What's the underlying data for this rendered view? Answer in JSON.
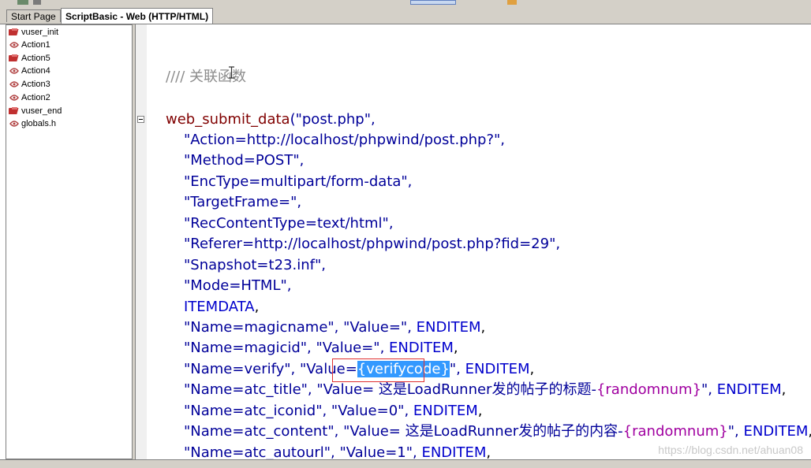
{
  "tabs": [
    {
      "label": "Start Page"
    },
    {
      "label": "ScriptBasic - Web (HTTP/HTML)"
    }
  ],
  "tree": {
    "items": [
      {
        "label": "vuser_init",
        "icon": "vuser-icon"
      },
      {
        "label": "Action1",
        "icon": "action-icon"
      },
      {
        "label": "Action5",
        "icon": "vuser-icon"
      },
      {
        "label": "Action4",
        "icon": "action-icon"
      },
      {
        "label": "Action3",
        "icon": "action-icon"
      },
      {
        "label": "Action2",
        "icon": "action-icon"
      },
      {
        "label": "vuser_end",
        "icon": "vuser-icon"
      },
      {
        "label": "globals.h",
        "icon": "action-icon"
      }
    ]
  },
  "code": {
    "comment": "//// 关联函数",
    "line1_fn": "web_submit_data",
    "line1_rest": "(\"post.php\",",
    "lines": [
      "\"Action=http://localhost/phpwind/post.php?\",",
      "\"Method=POST\",",
      "\"EncType=multipart/form-data\",",
      "\"TargetFrame=\",",
      "\"RecContentType=text/html\",",
      "\"Referer=http://localhost/phpwind/post.php?fid=29\",",
      "\"Snapshot=t23.inf\",",
      "\"Mode=HTML\","
    ],
    "itemdata": "ITEMDATA",
    "enditem": "ENDITEM",
    "row_magicname": "\"Name=magicname\", \"Value=\", ",
    "row_magicid": "\"Name=magicid\", \"Value=\", ",
    "row_verify_a": "\"Name=verify\", \"Value=",
    "row_verify_sel": "{verifycode}",
    "row_verify_b": "\", ",
    "row_title_a": "\"Name=atc_title\", \"Value= 这是LoadRunner发的帖子的标题-",
    "row_title_param": "{randomnum}",
    "row_title_b": "\", ",
    "row_iconid": "\"Name=atc_iconid\", \"Value=0\", ",
    "row_content_a": "\"Name=atc_content\", \"Value= 这是LoadRunner发的帖子的内容-",
    "row_content_param": "{randomnum}",
    "row_content_b": "\", ",
    "row_autourl": "\"Name=atc_autourl\", \"Value=1\", ",
    "comma": ","
  },
  "watermark": "https://blog.csdn.net/ahuan08",
  "colors": {
    "keyword": "#0000cc",
    "string": "#000099",
    "comment": "#8c8c8c",
    "param": "#a000a0",
    "selection": "#3399ff"
  }
}
